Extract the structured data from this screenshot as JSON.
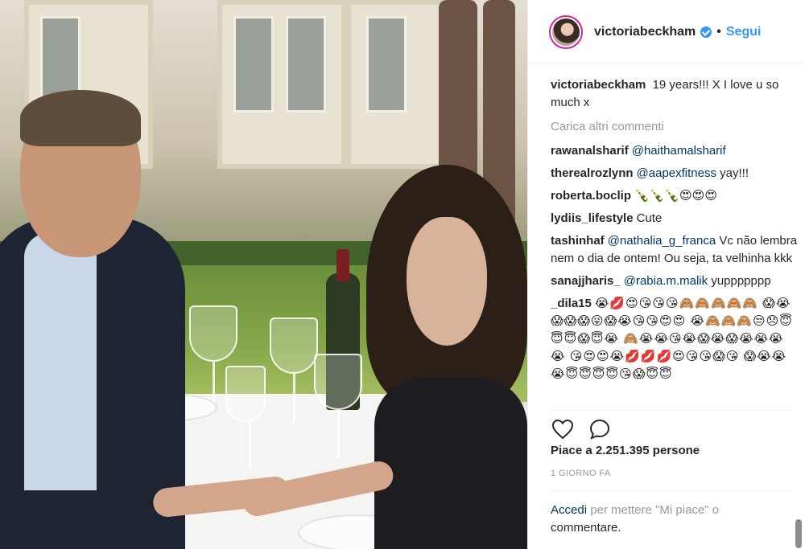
{
  "post": {
    "username": "victoriabeckham",
    "follow_label": "Segui",
    "dot": "•",
    "caption": {
      "user": "victoriabeckham",
      "text": "19 years!!! X I love u so much x"
    },
    "load_more": "Carica altri commenti",
    "comments": [
      {
        "user": "rawanalsharif",
        "mention": "@haithamalsharif",
        "text": ""
      },
      {
        "user": "therealrozlynn",
        "mention": "@aapexfitness",
        "text": "yay!!!"
      },
      {
        "user": "roberta.boclip",
        "mention": "",
        "text": "🍾🍾🍾😍😍😍"
      },
      {
        "user": "lydiis_lifestyle",
        "mention": "",
        "text": "Cute"
      },
      {
        "user": "tashinhaf",
        "mention": "@nathalia_g_franca",
        "text": "Vc não lembra nem o dia de ontem! Ou seja, ta velhinha kkk"
      },
      {
        "user": "sanajjharis_",
        "mention": "@rabia.m.malik",
        "text": "yuppppppp"
      },
      {
        "user": "_dila15",
        "mention": "",
        "text": "😭💋😍😘😘😘🙈🙈🙈🙈🙈 😱😭😱😱😱😜😱😭😘😘😍😍 😭🙈🙈🙈😒😞😇😇😇😱😇😭 🙈😭😭😘😭😱😭😱😭😭😭😭 😘😍😍😭💋💋💋😍😘😘😱😘 😱😭😭😭😇😇😇😇😘😱😇😇"
      }
    ],
    "likes": "Piace a 2.251.395 persone",
    "time_ago": "1 GIORNO FA",
    "login_link": "Accedi",
    "login_text_1": "per mettere \"Mi piace\" o",
    "login_text_2": "commentare.",
    "icons": {
      "like": "heart-outline-icon",
      "comment": "speech-bubble-icon"
    },
    "colors": {
      "link": "#3897f0",
      "mention": "#003569",
      "muted": "#999999",
      "verified": "#3897f0"
    }
  }
}
